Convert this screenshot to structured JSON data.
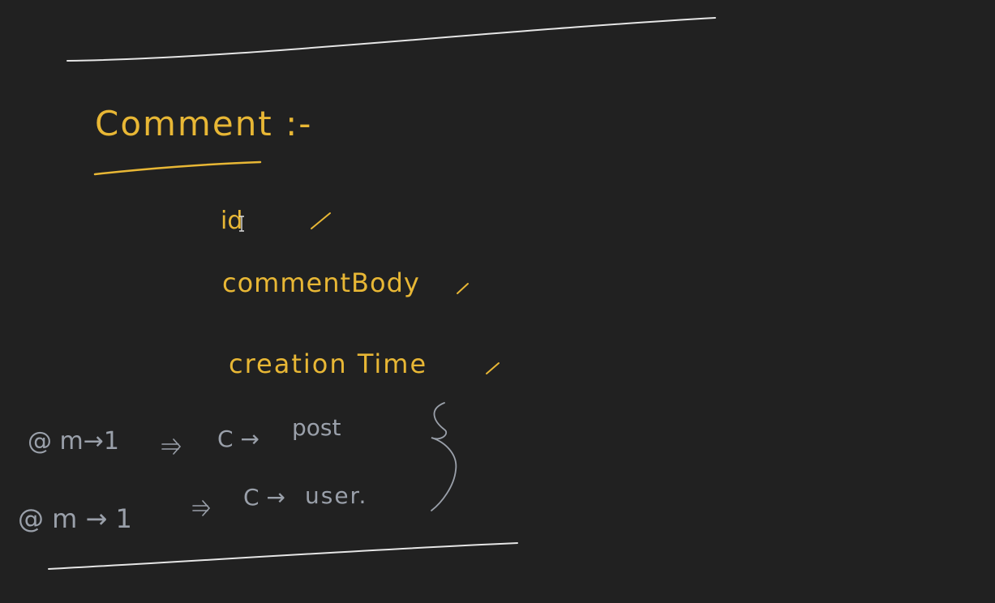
{
  "note": {
    "title": "Comment :-",
    "fields": [
      {
        "label": "id"
      },
      {
        "label": "commentBody"
      },
      {
        "label": "creation Time"
      }
    ],
    "relations": [
      {
        "annotation": "@ m→1",
        "target_prefix": "C →",
        "target": "post"
      },
      {
        "annotation": "@ m → 1",
        "target_prefix": "C →",
        "target": "user."
      }
    ]
  },
  "colors": {
    "background": "#212121",
    "title_ink": "#e8b735",
    "relation_ink": "#9aa0aa",
    "divider_ink": "#e6e6e6"
  },
  "icons": {
    "cursor": "text-cursor-icon",
    "checkmark": "check-tick-icon",
    "brace": "curly-brace-icon",
    "arrow": "double-arrow-icon"
  }
}
